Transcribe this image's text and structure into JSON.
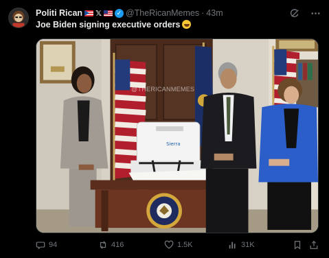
{
  "tweet": {
    "display_name": "Politi Rican",
    "handle": "@TheRicanMemes",
    "separator": "·",
    "time": "43m",
    "text": "Joe Biden signing executive orders",
    "watermark": "@THERICANMEMES"
  },
  "actions": {
    "replies": "94",
    "reposts": "416",
    "likes": "1.5K",
    "views": "31K"
  },
  "icons": {
    "avatar": "avatar-image",
    "grok": "grok-icon",
    "more": "more-icon",
    "reply": "reply-icon",
    "repost": "repost-icon",
    "like": "heart-icon",
    "views": "views-icon",
    "bookmark": "bookmark-icon",
    "share": "share-icon"
  },
  "colors": {
    "background": "#000000",
    "text_primary": "#e7e9ea",
    "text_secondary": "#71767b",
    "verified": "#1d9bf0"
  }
}
